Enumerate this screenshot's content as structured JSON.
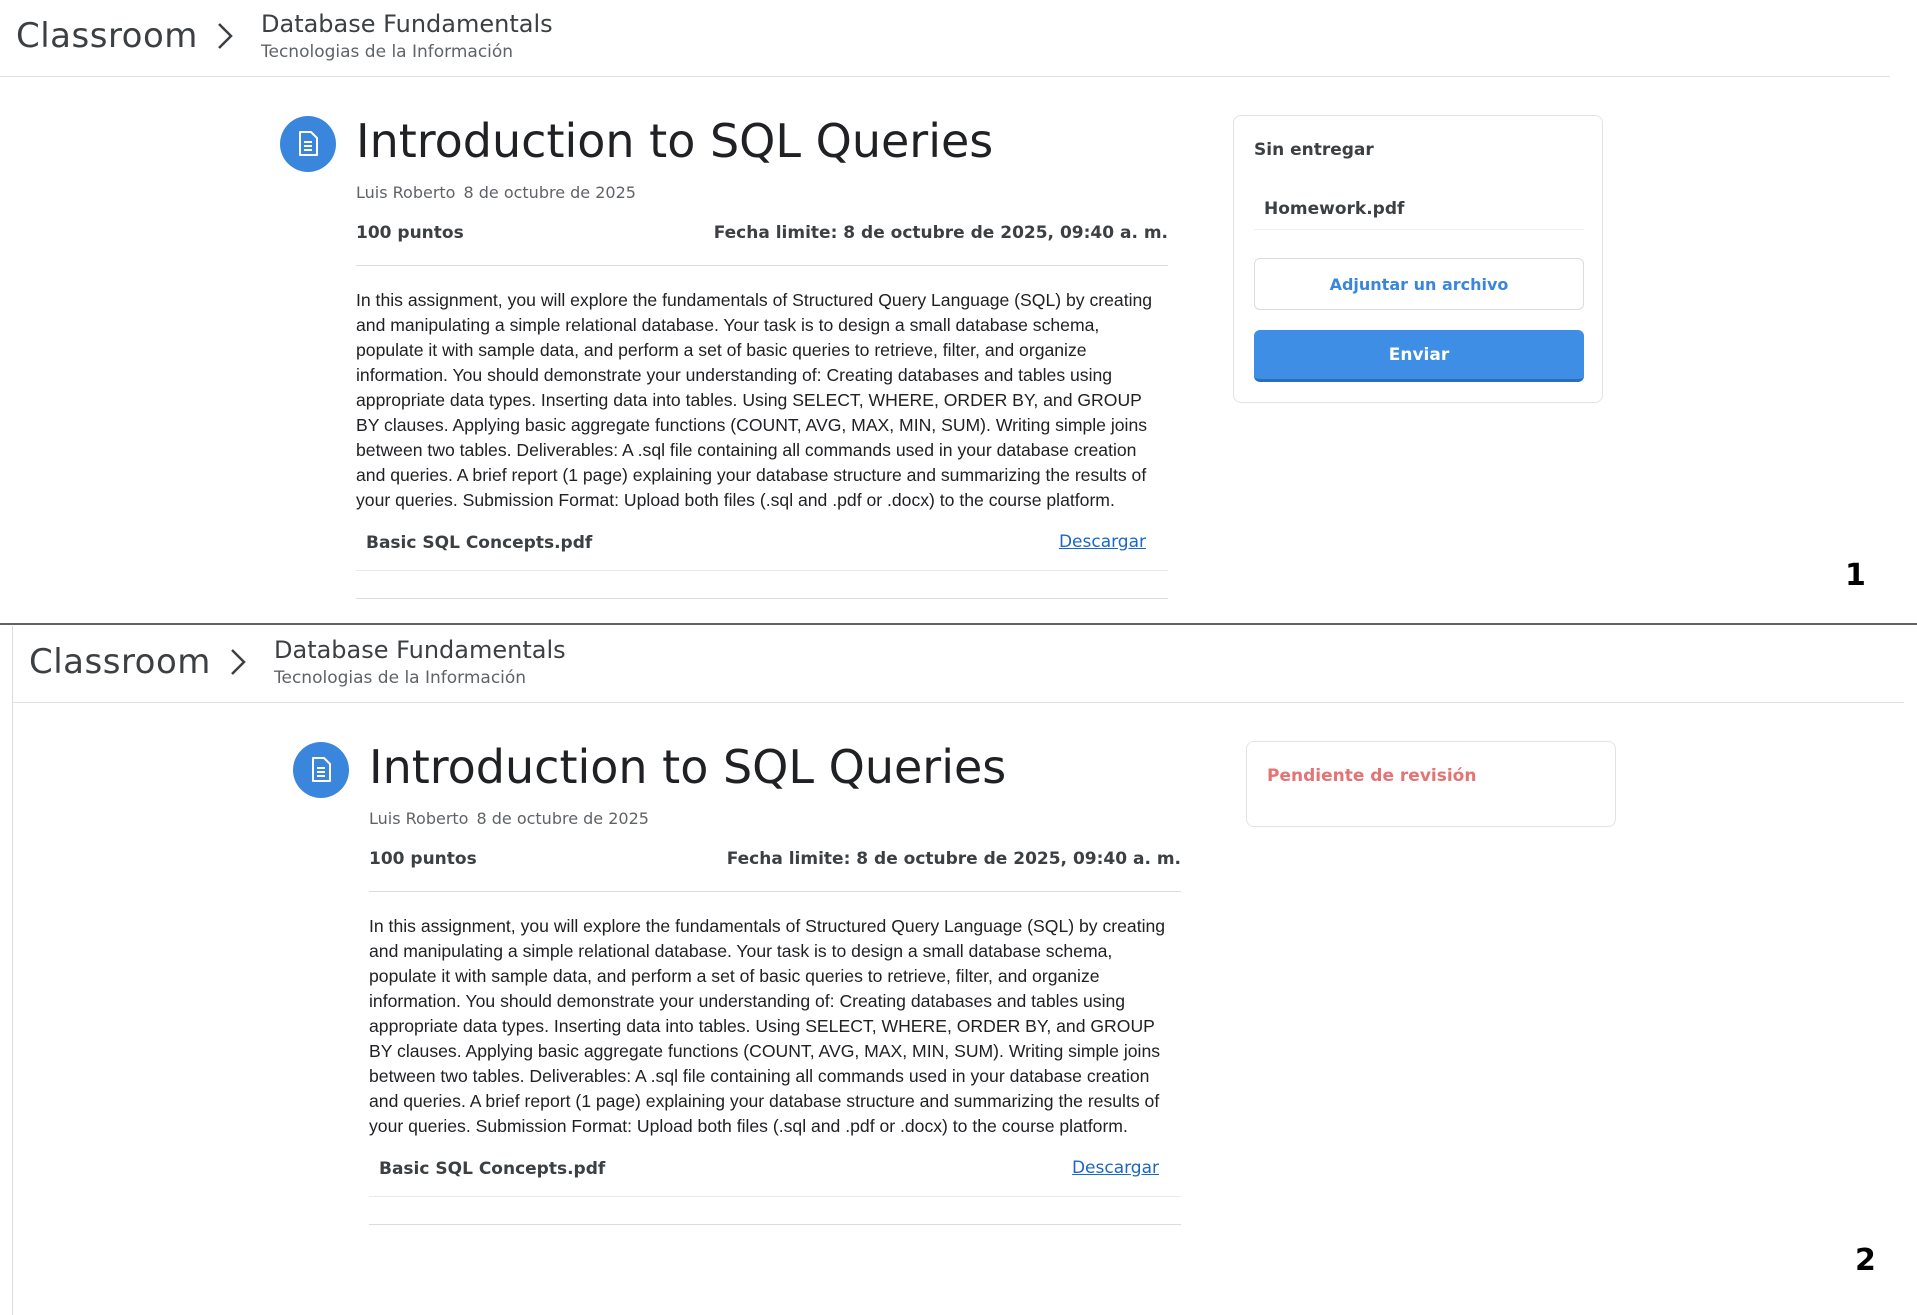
{
  "screens": [
    {
      "number": "1",
      "header": {
        "brand": "Classroom",
        "course_title": "Database Fundamentals",
        "course_subtitle": "Tecnologias de la Información"
      },
      "assignment": {
        "icon": "assignment-icon",
        "title": "Introduction to SQL Queries",
        "author": "Luis Roberto",
        "date": "8 de octubre de 2025",
        "points": "100 puntos",
        "due": "Fecha limite: 8 de octubre de 2025, 09:40 a. m.",
        "description": "In this assignment, you will explore the fundamentals of Structured Query Language (SQL) by creating and manipulating a simple relational database. Your task is to design a small database schema, populate it with sample data, and perform a set of basic queries to retrieve, filter, and organize information. You should demonstrate your understanding of: Creating databases and tables using appropriate data types. Inserting data into tables. Using SELECT, WHERE, ORDER BY, and GROUP BY clauses. Applying basic aggregate functions (COUNT, AVG, MAX, MIN, SUM). Writing simple joins between two tables. Deliverables: A .sql file containing all commands used in your database creation and queries. A brief report (1 page) explaining your database structure and summarizing the results of your queries. Submission Format: Upload both files (.sql and .pdf or .docx) to the course platform.",
        "attachment_name": "Basic SQL Concepts.pdf",
        "attachment_link": "Descargar"
      },
      "submission": {
        "status": "Sin entregar",
        "file_name": "Homework.pdf",
        "attach_button": "Adjuntar un archivo",
        "send_button": "Enviar"
      }
    },
    {
      "number": "2",
      "header": {
        "brand": "Classroom",
        "course_title": "Database Fundamentals",
        "course_subtitle": "Tecnologias de la Información"
      },
      "assignment": {
        "icon": "assignment-icon",
        "title": "Introduction to SQL Queries",
        "author": "Luis Roberto",
        "date": "8 de octubre de 2025",
        "points": "100 puntos",
        "due": "Fecha limite: 8 de octubre de 2025, 09:40 a. m.",
        "description": "In this assignment, you will explore the fundamentals of Structured Query Language (SQL) by creating and manipulating a simple relational database. Your task is to design a small database schema, populate it with sample data, and perform a set of basic queries to retrieve, filter, and organize information. You should demonstrate your understanding of: Creating databases and tables using appropriate data types. Inserting data into tables. Using SELECT, WHERE, ORDER BY, and GROUP BY clauses. Applying basic aggregate functions (COUNT, AVG, MAX, MIN, SUM). Writing simple joins between two tables. Deliverables: A .sql file containing all commands used in your database creation and queries. A brief report (1 page) explaining your database structure and summarizing the results of your queries. Submission Format: Upload both files (.sql and .pdf or .docx) to the course platform.",
        "attachment_name": "Basic SQL Concepts.pdf",
        "attachment_link": "Descargar"
      },
      "submission": {
        "status": "Pendiente de revisión"
      }
    }
  ],
  "colors": {
    "accent": "#3b86dd",
    "pending": "#e57373",
    "link": "#1a66c9"
  }
}
